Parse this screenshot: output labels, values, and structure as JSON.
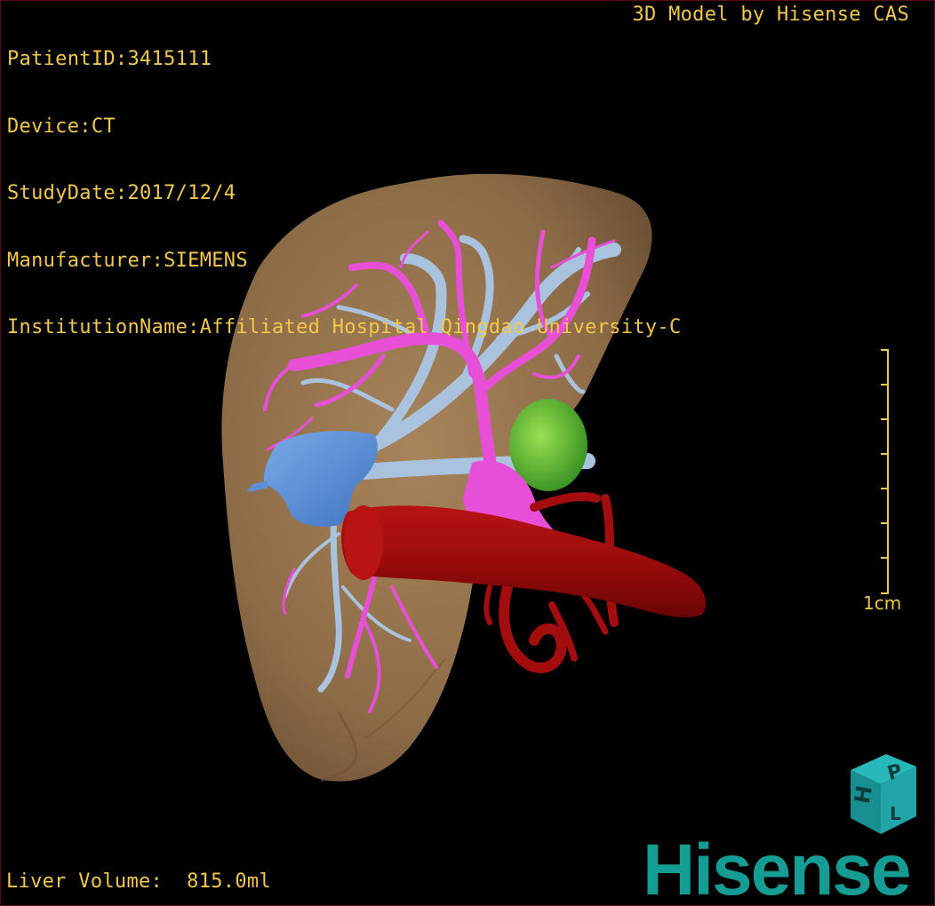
{
  "overlay": {
    "patient_id": "PatientID:3415111",
    "device": "Device:CT",
    "study_date": "StudyDate:2017/12/4",
    "manufacturer": "Manufacturer:SIEMENS",
    "institution": "InstitutionName:Affiliated Hospital Qingdao University-C",
    "credit": "3D Model by Hisense CAS",
    "liver_volume": "Liver Volume:  815.0ml"
  },
  "scale": {
    "label": "1cm"
  },
  "orientation_cube": {
    "face_top": "P",
    "face_left": "H",
    "face_front": "L"
  },
  "brand": {
    "logo_text": "Hisense"
  },
  "colors": {
    "overlay_text": "#f2c84a",
    "liver": "#9c7a52",
    "portal_vein": "#e64fd6",
    "hepatic_vein": "#a9c3df",
    "vena_cava": "#5b8fd6",
    "aorta": "#a30d0d",
    "gallbladder": "#6fc23a",
    "brand": "#159c93"
  }
}
